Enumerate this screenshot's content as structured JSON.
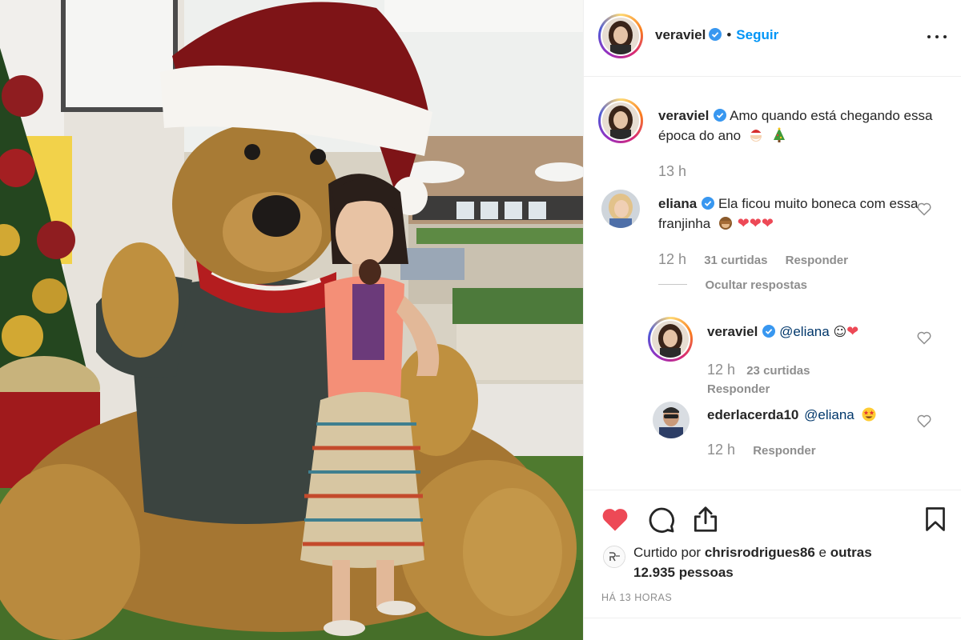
{
  "author": {
    "username": "veraviel",
    "verified": true,
    "follow_label": "Seguir",
    "separator": "•"
  },
  "caption": {
    "username": "veraviel",
    "text": "Amo quando está chegando essa época do ano",
    "emojis": [
      "santa-emoji",
      "christmas-tree-emoji"
    ],
    "time": "13 h"
  },
  "comments": [
    {
      "username": "eliana",
      "verified": true,
      "text": "Ela ficou muito boneca com essa franjinha",
      "emojis": [
        "see-no-evil-monkey-emoji",
        "red-heart",
        "red-heart",
        "red-heart"
      ],
      "time": "12 h",
      "likes": "31 curtidas",
      "reply_label": "Responder",
      "hide_replies": "Ocultar respostas",
      "replies": [
        {
          "username": "veraviel",
          "verified": true,
          "mention": "@eliana",
          "emojis": [
            "smiling-face",
            "red-heart"
          ],
          "time": "12 h",
          "likes": "23 curtidas",
          "reply_label": "Responder"
        },
        {
          "username": "ederlacerda10",
          "verified": false,
          "mention": "@eliana",
          "emojis": [
            "star-struck-emoji"
          ],
          "time": "12 h",
          "reply_label": "Responder"
        }
      ]
    }
  ],
  "actions": {
    "liked": true,
    "icons": [
      "heart-icon",
      "comment-icon",
      "share-icon",
      "bookmark-icon"
    ]
  },
  "likes": {
    "prefix": "Curtido por",
    "user": "chrisrodrigues86",
    "suffix": "e",
    "others": "outras 12.935 pessoas"
  },
  "posted": "HÁ 13 HORAS",
  "colors": {
    "accent": "#0095f6",
    "like_red": "#ed4956",
    "muted": "#8e8e8e",
    "text": "#262626"
  }
}
